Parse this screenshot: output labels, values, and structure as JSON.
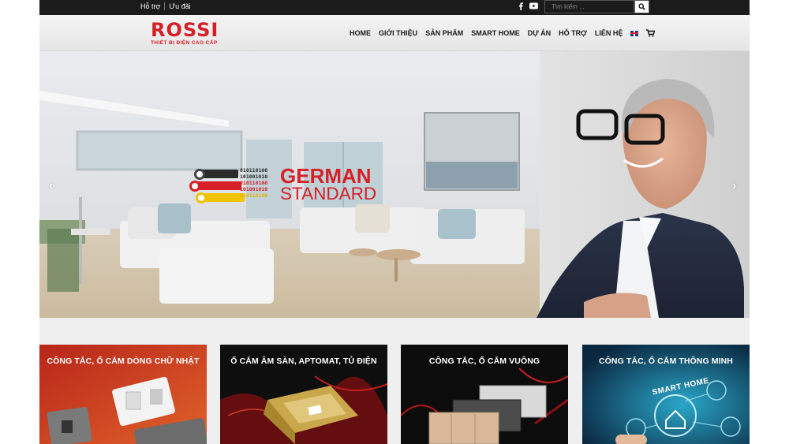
{
  "topbar": {
    "links": [
      "Hỗ trợ",
      "Ưu đãi"
    ],
    "social_icons": [
      "facebook-icon",
      "youtube-icon"
    ],
    "search_placeholder": "Tìm kiếm ..."
  },
  "logo": {
    "brand": "ROSSI",
    "tagline": "THIẾT BỊ ĐIỆN CAO CẤP"
  },
  "nav": {
    "items": [
      "HOME",
      "GIỚI THIỆU",
      "SẢN PHẨM",
      "SMART HOME",
      "DỰ ÁN",
      "HỖ TRỢ",
      "LIÊN HỆ"
    ],
    "language_icon": "uk-flag-icon",
    "cart_icon": "cart-icon"
  },
  "hero": {
    "badge_line1": "GERMAN",
    "badge_line2": "STANDARD",
    "bits": [
      "010110100",
      "101001010",
      "010110100",
      "101001010",
      "010110100"
    ],
    "prev_arrow": "‹",
    "next_arrow": "›",
    "flag_colors": [
      "#2b2b2b",
      "#d61f26",
      "#f2c300"
    ]
  },
  "categories": [
    {
      "title": "CÔNG TẮC, Ổ CẮM DÒNG CHỮ NHẬT"
    },
    {
      "title": "Ổ CẮM ÂM SÀN, APTOMAT, TỦ ĐIỆN"
    },
    {
      "title": "CÔNG TẮC, Ổ CẮM VUÔNG"
    },
    {
      "title": "CÔNG TẮC, Ổ CẮM THÔNG MINH"
    }
  ],
  "card_art_text": "SMART HOME"
}
